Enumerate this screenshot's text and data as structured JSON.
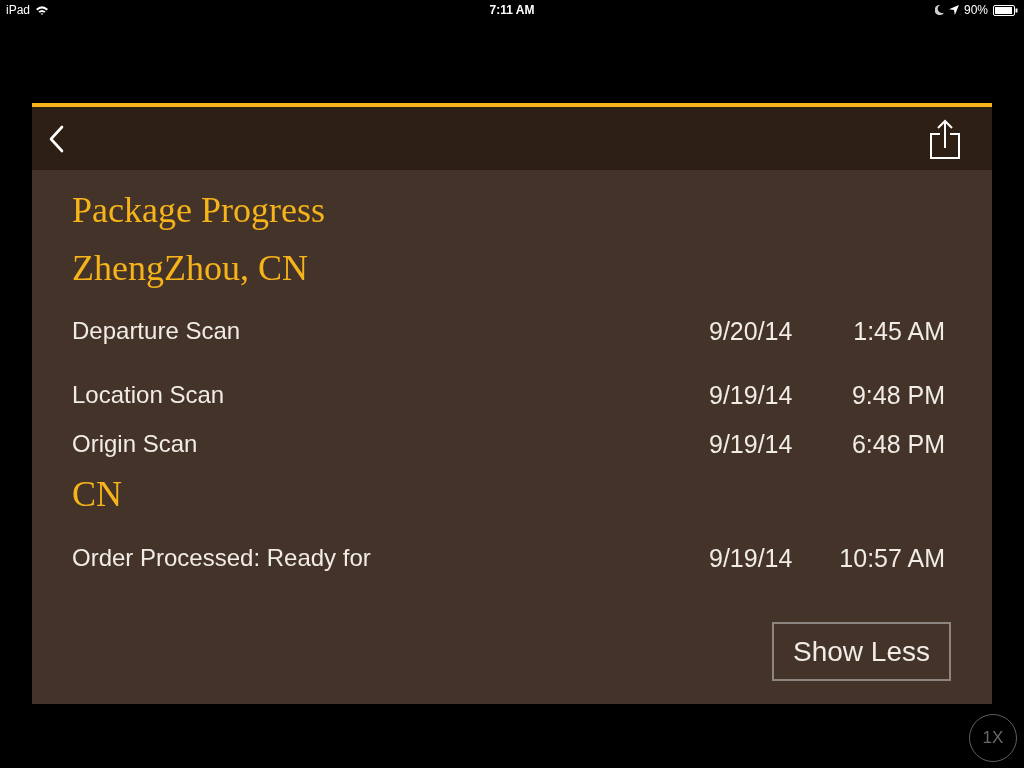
{
  "status_bar": {
    "device": "iPad",
    "time": "7:11 AM",
    "battery": "90%"
  },
  "title": "Package Progress",
  "groups": [
    {
      "location": "ZhengZhou, CN",
      "events": [
        {
          "activity": "Departure Scan",
          "date": "9/20/14",
          "time": "1:45 AM"
        },
        {
          "activity": "Location Scan",
          "date": "9/19/14",
          "time": "9:48 PM"
        },
        {
          "activity": "Origin Scan",
          "date": "9/19/14",
          "time": "6:48 PM"
        }
      ]
    },
    {
      "location": "CN",
      "events": [
        {
          "activity": "Order Processed: Ready for",
          "date": "9/19/14",
          "time": "10:57 AM"
        }
      ]
    }
  ],
  "show_less_button": "Show Less",
  "zoom_button": "1X"
}
